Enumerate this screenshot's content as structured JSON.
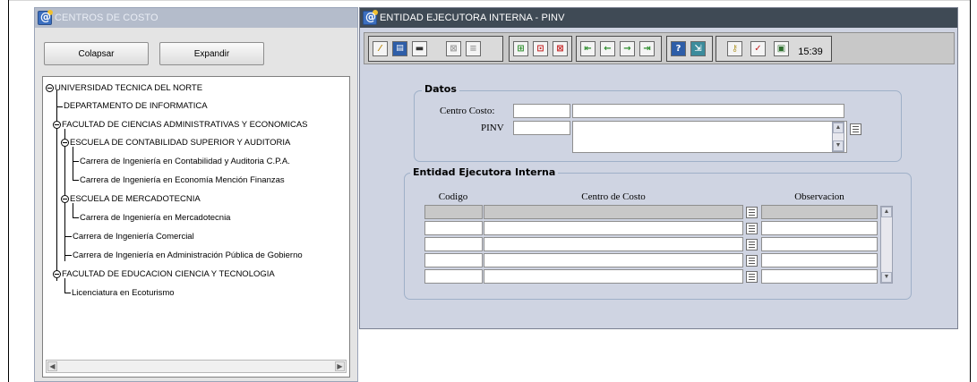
{
  "left_window": {
    "title": "CENTROS DE COSTO",
    "collapse_label": "Colapsar",
    "expand_label": "Expandir",
    "tree": [
      "UNIVERSIDAD TECNICA DEL NORTE",
      "DEPARTAMENTO DE INFORMATICA",
      "FACULTAD DE CIENCIAS ADMINISTRATIVAS Y ECONOMICAS",
      "ESCUELA DE CONTABILIDAD SUPERIOR Y AUDITORIA",
      "Carrera de Ingeniería en Contabilidad y Auditoria C.P.A.",
      "Carrera de Ingeniería en Economía Mención Finanzas",
      "ESCUELA DE MERCADOTECNIA",
      "Carrera de Ingeniería en Mercadotecnia",
      "Carrera de Ingeniería Comercial",
      "Carrera de Ingeniería en Administración Pública de Gobierno",
      "FACULTAD DE EDUCACION CIENCIA Y TECNOLOGIA",
      "Licenciatura en Ecoturismo"
    ]
  },
  "right_window": {
    "title": "ENTIDAD EJECUTORA INTERNA - PINV",
    "clock": "15:39",
    "datos": {
      "group_title": "Datos",
      "centro_costo_label": "Centro Costo:",
      "pinv_label": "PINV",
      "centro_costo_code": "",
      "centro_costo_name": "",
      "pinv_code": "",
      "pinv_desc": ""
    },
    "entidad": {
      "group_title": "Entidad Ejecutora Interna",
      "col_codigo": "Codigo",
      "col_centro": "Centro de Costo",
      "col_observacion": "Observacion",
      "rows": [
        {
          "codigo": "",
          "centro": "",
          "observacion": ""
        },
        {
          "codigo": "",
          "centro": "",
          "observacion": ""
        },
        {
          "codigo": "",
          "centro": "",
          "observacion": ""
        },
        {
          "codigo": "",
          "centro": "",
          "observacion": ""
        },
        {
          "codigo": "",
          "centro": "",
          "observacion": ""
        }
      ]
    }
  },
  "icons": {
    "toolbar": [
      "broom-icon",
      "save-icon",
      "print-icon",
      "query-icon",
      "list-icon",
      "insert-record-icon",
      "edit-record-icon",
      "delete-record-icon",
      "first-record-icon",
      "previous-record-icon",
      "next-record-icon",
      "last-record-icon",
      "help-icon",
      "exit-icon",
      "key-icon",
      "check-icon",
      "calendar-icon"
    ]
  },
  "colors": {
    "left_title_bg": "#b4bccb",
    "right_title_bg": "#3f4a55",
    "form_bg": "#cfd4e2",
    "toolbar_green": "#2f8f2f",
    "toolbar_red": "#c42020"
  }
}
